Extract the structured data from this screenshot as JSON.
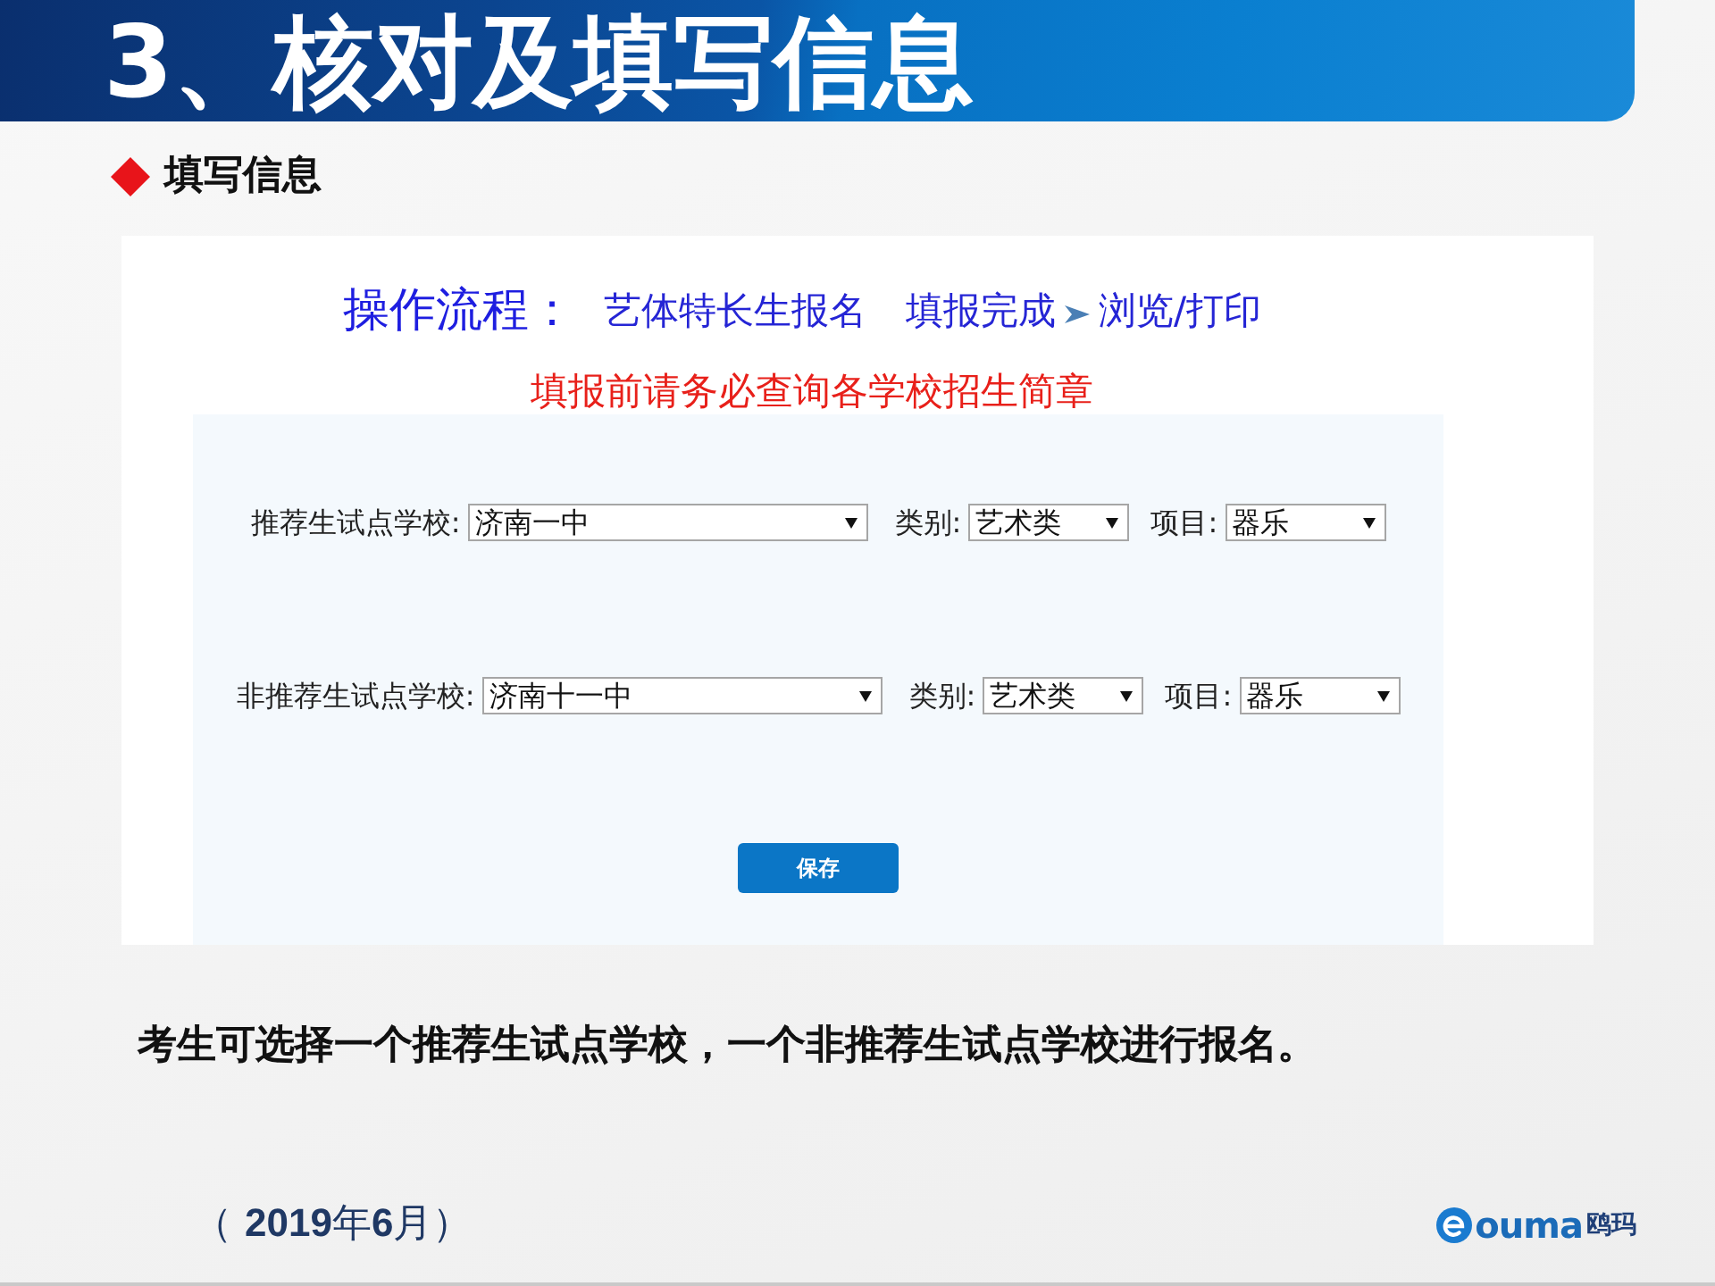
{
  "header": {
    "title": "3、核对及填写信息"
  },
  "section": {
    "heading": "填写信息"
  },
  "screenshot": {
    "process": {
      "label": "操作流程：",
      "steps": [
        {
          "label": "艺体特长生报名",
          "arrow_before": false
        },
        {
          "label": "填报完成",
          "arrow_before": false
        },
        {
          "label": "浏览/打印",
          "arrow_before": true
        }
      ]
    },
    "notice": "填报前请务必查询各学校招生简章",
    "form": {
      "rows": [
        {
          "school_label": "推荐生试点学校:",
          "school": "济南一中",
          "category_label": "类别:",
          "category": "艺术类",
          "item_label": "项目:",
          "item": "器乐"
        },
        {
          "school_label": "非推荐生试点学校:",
          "school": "济南十一中",
          "category_label": "类别:",
          "category": "艺术类",
          "item_label": "项目:",
          "item": "器乐"
        }
      ],
      "save_button": "保存"
    }
  },
  "note": "考生可选择一个推荐生试点学校，一个非推荐生试点学校进行报名。",
  "footer": {
    "date": "（ **2019**年**6**月）",
    "logo": {
      "brand": "ouma",
      "brand_cn": "鸥玛"
    }
  }
}
